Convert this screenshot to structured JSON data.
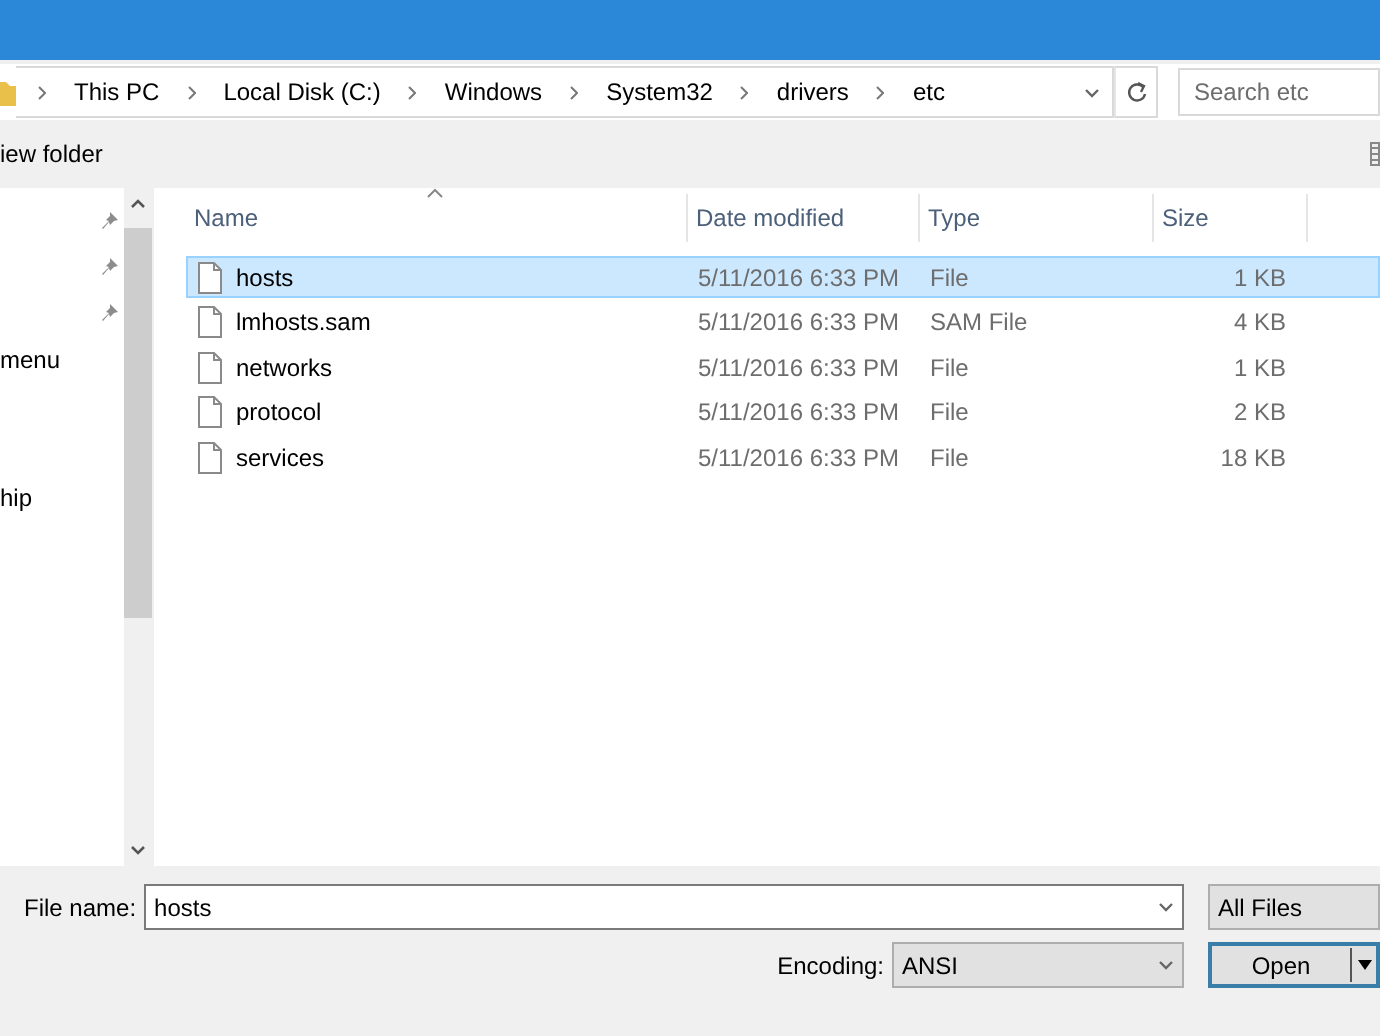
{
  "breadcrumbs": [
    "This PC",
    "Local Disk (C:)",
    "Windows",
    "System32",
    "drivers",
    "etc"
  ],
  "search": {
    "placeholder": "Search etc"
  },
  "toolbar": {
    "new_folder": "iew folder"
  },
  "nav_items": [
    {
      "pinned": true
    },
    {
      "pinned": true
    },
    {
      "pinned": true
    },
    {
      "label": "menu",
      "pinned": false
    },
    {
      "pinned": false
    },
    {
      "pinned": false
    },
    {
      "label": "hip",
      "pinned": false
    }
  ],
  "columns": [
    "Name",
    "Date modified",
    "Type",
    "Size"
  ],
  "files": [
    {
      "name": "hosts",
      "date": "5/11/2016 6:33 PM",
      "type": "File",
      "size": "1 KB",
      "selected": true
    },
    {
      "name": "lmhosts.sam",
      "date": "5/11/2016 6:33 PM",
      "type": "SAM File",
      "size": "4 KB",
      "selected": false
    },
    {
      "name": "networks",
      "date": "5/11/2016 6:33 PM",
      "type": "File",
      "size": "1 KB",
      "selected": false
    },
    {
      "name": "protocol",
      "date": "5/11/2016 6:33 PM",
      "type": "File",
      "size": "2 KB",
      "selected": false
    },
    {
      "name": "services",
      "date": "5/11/2016 6:33 PM",
      "type": "File",
      "size": "18 KB",
      "selected": false
    }
  ],
  "file_name": {
    "label": "File name:",
    "value": "hosts"
  },
  "file_type": "All Files",
  "encoding": {
    "label": "Encoding:",
    "value": "ANSI"
  },
  "open_button": "Open"
}
